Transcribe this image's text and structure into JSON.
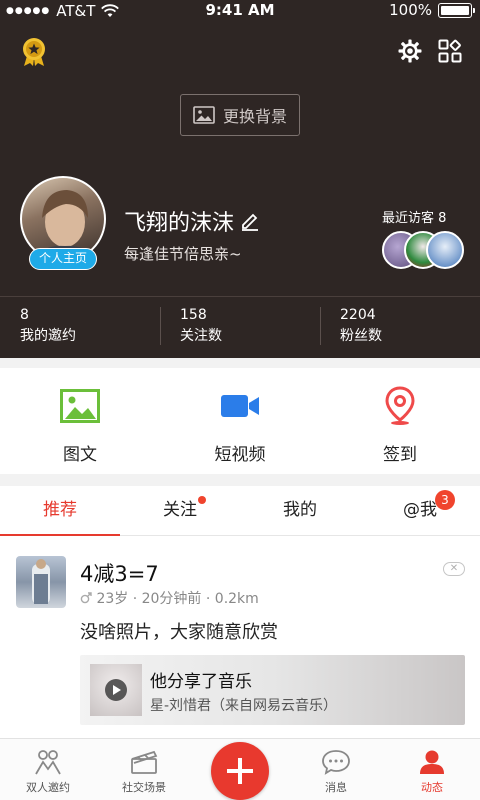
{
  "status_bar": {
    "signal_dots": "●●●●●",
    "carrier": "AT&T",
    "time": "9:41 AM",
    "battery_pct": "100%"
  },
  "header": {
    "change_bg_label": "更换背景",
    "profile_badge": "个人主页",
    "username": "飞翔的沫沫",
    "signature": "每逢佳节倍思亲~",
    "recent_visitors_label": "最近访客 8",
    "accent_color": "#e63a2e",
    "header_bg": "#2e2624"
  },
  "stats": [
    {
      "value": "8",
      "label": "我的邀约"
    },
    {
      "value": "158",
      "label": "关注数"
    },
    {
      "value": "2204",
      "label": "粉丝数"
    }
  ],
  "actions": [
    {
      "label": "图文",
      "icon": "image-icon"
    },
    {
      "label": "短视频",
      "icon": "video-camera-icon"
    },
    {
      "label": "签到",
      "icon": "location-pin-icon"
    }
  ],
  "tabs": [
    {
      "label": "推荐",
      "active": true
    },
    {
      "label": "关注",
      "has_dot": true
    },
    {
      "label": "我的"
    },
    {
      "label": "@我",
      "badge": "3"
    }
  ],
  "post": {
    "title": "4减3=7",
    "meta": "23岁 · 20分钟前 · 0.2km",
    "text": "没啥照片，大家随意欣赏",
    "music_title": "他分享了音乐",
    "music_sub": "星-刘惜君（来自网易云音乐）"
  },
  "bottom_nav": [
    {
      "label": "双人邀约",
      "icon": "two-people-icon"
    },
    {
      "label": "社交场景",
      "icon": "clapperboard-icon"
    },
    {
      "label": "",
      "icon": "plus-icon"
    },
    {
      "label": "消息",
      "icon": "chat-bubble-icon"
    },
    {
      "label": "动态",
      "icon": "person-icon",
      "active": true
    }
  ]
}
